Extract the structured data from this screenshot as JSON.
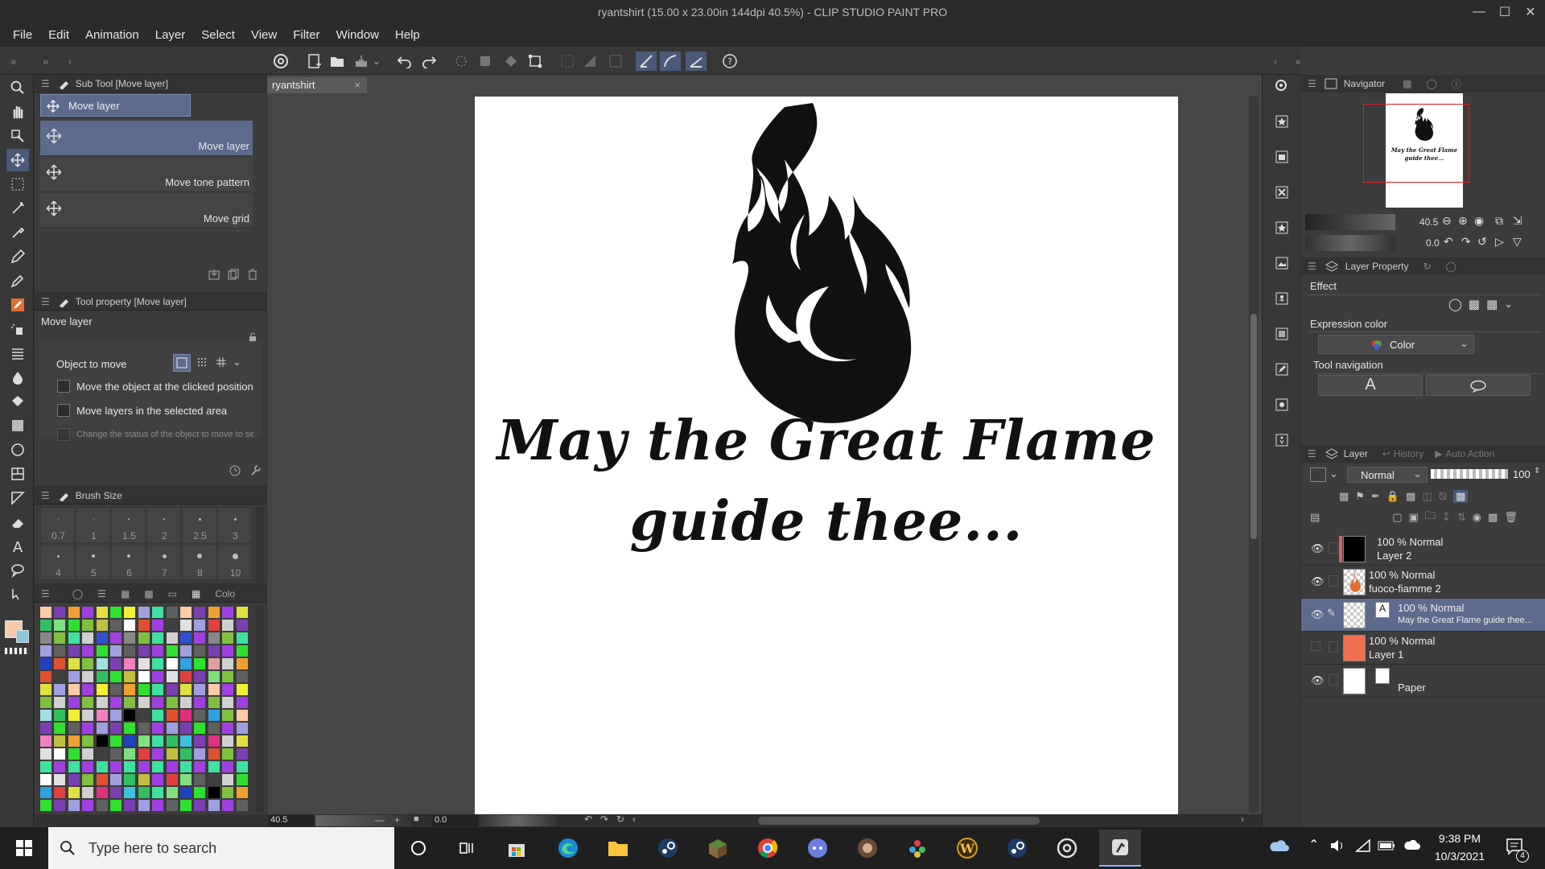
{
  "window": {
    "title": "ryantshirt (15.00 x 23.00in 144dpi 40.5%)  - CLIP STUDIO PAINT PRO"
  },
  "menu": [
    "File",
    "Edit",
    "Animation",
    "Layer",
    "Select",
    "View",
    "Filter",
    "Window",
    "Help"
  ],
  "subtool": {
    "header": "Sub Tool [Move layer]",
    "group_tab": "Move layer",
    "items": [
      "Move layer",
      "Move tone pattern",
      "Move grid"
    ]
  },
  "toolprop": {
    "header": "Tool property [Move layer]",
    "title": "Move layer",
    "object_to_move": "Object to move",
    "opt1": "Move the object at the clicked position",
    "opt2": "Move layers in the selected area",
    "opt3": "Change the status of the object to move to selecte"
  },
  "brushsize": {
    "header": "Brush Size",
    "row1": [
      "0.7",
      "1",
      "1.5",
      "2",
      "2.5",
      "3"
    ],
    "row2": [
      "4",
      "5",
      "6",
      "7",
      "8",
      "10"
    ]
  },
  "colorset": {
    "tab": "Colo"
  },
  "document": {
    "tab": "ryantshirt",
    "line1": "May the Great Flame",
    "line2": "guide thee..."
  },
  "navigator": {
    "header": "Navigator",
    "zoom": "40.5",
    "rotate": "0.0",
    "thumb_line1": "May the Great Flame",
    "thumb_line2": "guide thee..."
  },
  "layerprop": {
    "header": "Layer Property",
    "effect": "Effect",
    "expression_color": "Expression color",
    "color_value": "Color",
    "tool_nav": "Tool navigation",
    "tool_nav_a": "A"
  },
  "layers_panel": {
    "tabs": [
      "Layer",
      "History",
      "Auto Action"
    ],
    "blend": "Normal",
    "opacity": "100",
    "layers": [
      {
        "mode": "100 % Normal",
        "name": "Layer 2",
        "thumb": "#000000"
      },
      {
        "mode": "100 % Normal",
        "name": "fuoco-fiamme 2",
        "thumb": "checker"
      },
      {
        "mode": "100 % Normal",
        "name": "May the Great Flame  guide thee...",
        "thumb": "checker"
      },
      {
        "mode": "100 % Normal",
        "name": "Layer 1",
        "thumb": "#f07050"
      },
      {
        "mode": "",
        "name": "Paper",
        "thumb": "#ffffff"
      }
    ]
  },
  "statusbar": {
    "zoom": "40.5",
    "rotate": "0.0"
  },
  "taskbar": {
    "search_placeholder": "Type here to search",
    "time": "9:38 PM",
    "date": "10/3/2021",
    "notif_count": "4"
  },
  "colors": {
    "accent": "#5c6b8c",
    "panel": "#3c3c3c",
    "dark": "#2b2b2b"
  }
}
